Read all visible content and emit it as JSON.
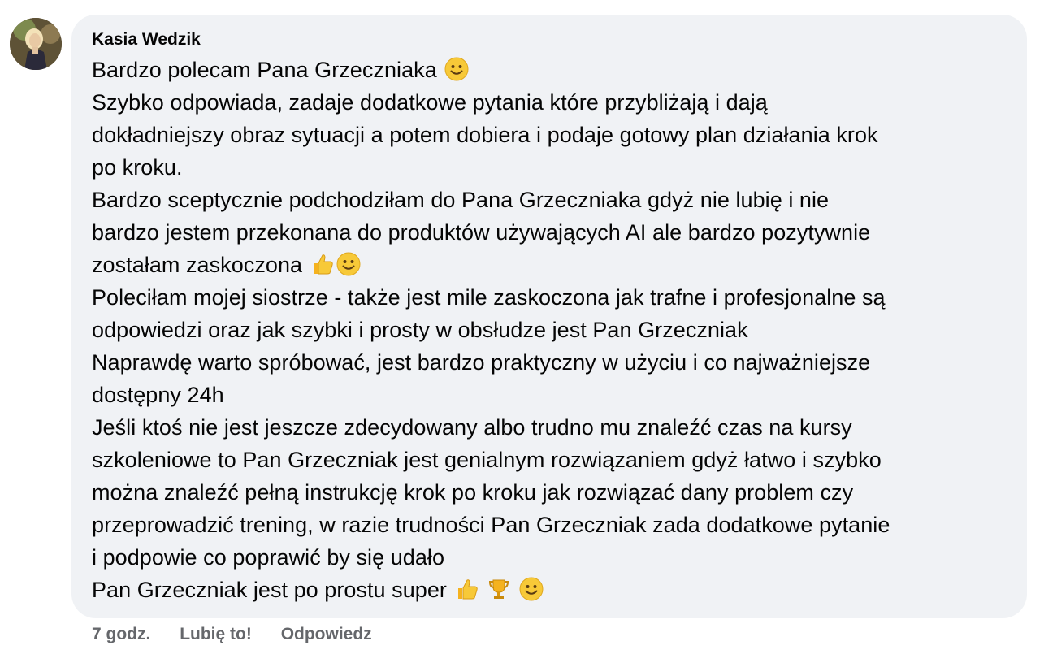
{
  "comment": {
    "author": "Kasia Wedzik",
    "lines": [
      "Bardzo polecam Pana Grzeczniaka",
      "Szybko odpowiada, zadaje dodatkowe pytania które przybliżają i dają",
      "dokładniejszy obraz sytuacji a potem dobiera i podaje gotowy plan działania krok",
      "po kroku.",
      "Bardzo sceptycznie podchodziłam do Pana Grzeczniaka gdyż nie lubię i nie",
      "bardzo jestem przekonana do produktów używających AI ale bardzo pozytywnie",
      "zostałam zaskoczona",
      "Poleciłam mojej siostrze - także jest mile zaskoczona jak trafne i profesjonalne są",
      "odpowiedzi oraz jak szybki i prosty w obsłudze jest Pan Grzeczniak",
      "Naprawdę warto spróbować, jest bardzo praktyczny w użyciu i co najważniejsze",
      "dostępny 24h",
      "Jeśli ktoś nie jest jeszcze zdecydowany albo trudno mu znaleźć czas na kursy",
      "szkoleniowe to Pan Grzeczniak jest genialnym rozwiązaniem gdyż łatwo i szybko",
      "można znaleźć pełną instrukcję krok po kroku jak rozwiązać dany problem czy",
      "przeprowadzić trening, w razie trudności Pan Grzeczniak zada dodatkowe pytanie",
      "i podpowie co poprawić by się udało",
      "Pan Grzeczniak jest po prostu super"
    ],
    "emoji_icons": [
      "smiling-face-icon",
      "thumbs-up-icon",
      "trophy-icon"
    ]
  },
  "actions": {
    "time": "7 godz.",
    "like_label": "Lubię to!",
    "reply_label": "Odpowiedz"
  },
  "colors": {
    "bubble_bg": "#f0f2f5",
    "text": "#050505",
    "secondary_text": "#65676b"
  }
}
